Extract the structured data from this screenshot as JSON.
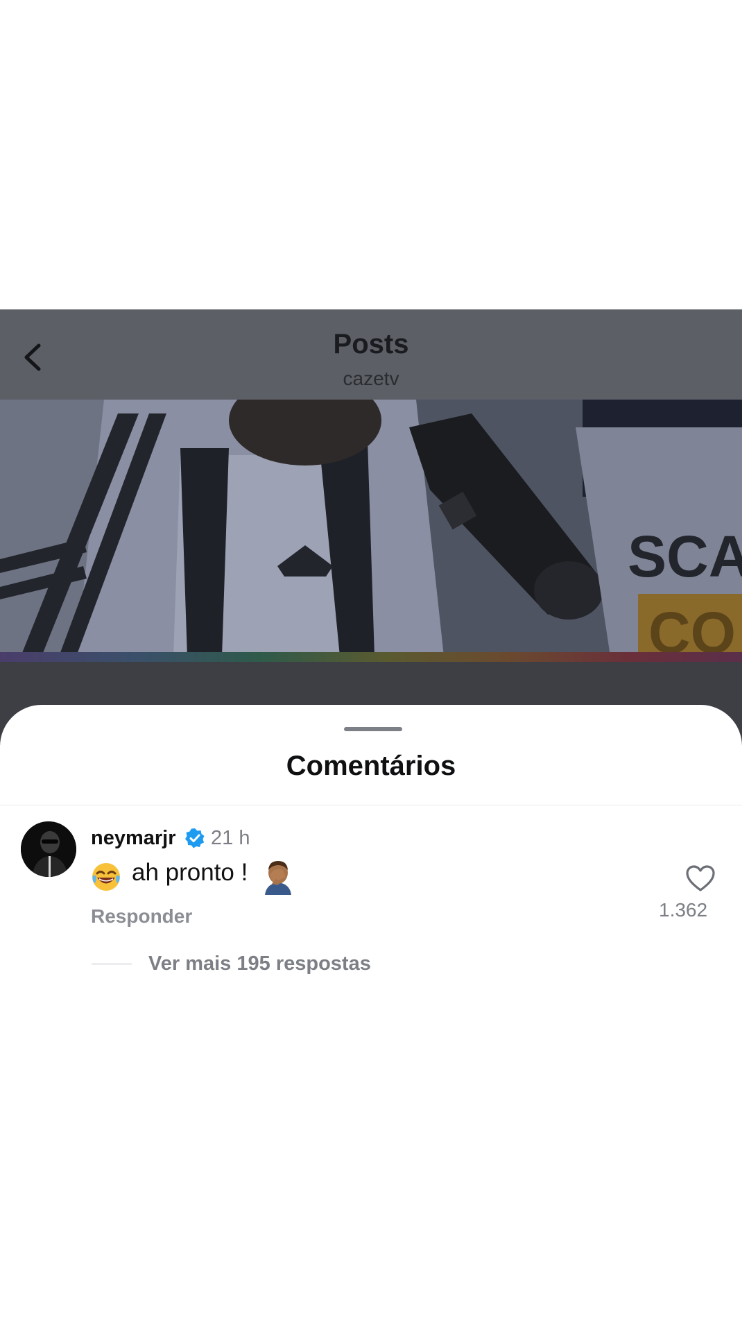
{
  "header": {
    "title": "Posts",
    "subtitle": "cazetv",
    "back_icon": "chevron-left-icon"
  },
  "media": {
    "overlay_text_1": "SCA",
    "overlay_text_2": "CO"
  },
  "comments_sheet": {
    "title": "Comentários"
  },
  "comment": {
    "username": "neymarjr",
    "verified_icon": "verified-badge-icon",
    "timestamp": "21 h",
    "text": "ah pronto !",
    "emojis": [
      "laughing-face-emoji",
      "facepalm-emoji"
    ],
    "reply_label": "Responder",
    "like_icon": "heart-outline-icon",
    "like_count": "1.362",
    "view_replies_label": "Ver mais 195 respostas"
  },
  "colors": {
    "verified_blue": "#1d9bf0",
    "secondary_text": "#7c7f85",
    "dim_overlay": "#5c5f66"
  }
}
